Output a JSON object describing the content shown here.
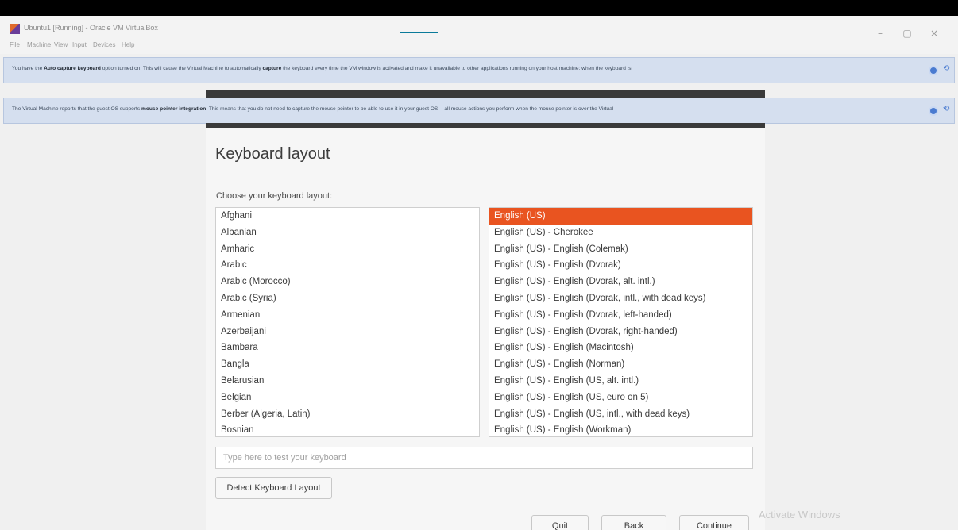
{
  "window": {
    "title": "Ubuntu1 [Running] - Oracle VM VirtualBox",
    "minimize_label": "–",
    "maximize_label": "▢",
    "close_label": "×"
  },
  "menu": [
    "File",
    "Machine",
    "View",
    "Input",
    "Devices",
    "Help"
  ],
  "notices": {
    "keyboard": {
      "pre": "You have the ",
      "bold1": "Auto capture keyboard",
      "mid1": " option turned on. This will cause the Virtual Machine to automatically ",
      "bold2": "capture",
      "post": " the keyboard every time the VM window is activated and make it unavailable to other applications running on your host machine: when the keyboard is"
    },
    "mouse": {
      "pre": "The Virtual Machine reports that the guest OS supports ",
      "bold": "mouse pointer integration",
      "post": ". This means that you do not need to capture the mouse pointer to be able to use it in your guest OS -- all mouse actions you perform when the mouse pointer is over the Virtual"
    },
    "close_label": "⟲"
  },
  "installer": {
    "title": "Keyboard layout",
    "choose_label": "Choose your keyboard layout:",
    "layouts": [
      "Afghani",
      "Albanian",
      "Amharic",
      "Arabic",
      "Arabic (Morocco)",
      "Arabic (Syria)",
      "Armenian",
      "Azerbaijani",
      "Bambara",
      "Bangla",
      "Belarusian",
      "Belgian",
      "Berber (Algeria, Latin)",
      "Bosnian"
    ],
    "variants": [
      "English (US)",
      "English (US) - Cherokee",
      "English (US) - English (Colemak)",
      "English (US) - English (Dvorak)",
      "English (US) - English (Dvorak, alt. intl.)",
      "English (US) - English (Dvorak, intl., with dead keys)",
      "English (US) - English (Dvorak, left-handed)",
      "English (US) - English (Dvorak, right-handed)",
      "English (US) - English (Macintosh)",
      "English (US) - English (Norman)",
      "English (US) - English (US, alt. intl.)",
      "English (US) - English (US, euro on 5)",
      "English (US) - English (US, intl., with dead keys)",
      "English (US) - English (Workman)"
    ],
    "selected_variant": "English (US)",
    "test_placeholder": "Type here to test your keyboard",
    "detect_button": "Detect Keyboard Layout",
    "quit_button": "Quit",
    "back_button": "Back",
    "continue_button": "Continue"
  },
  "watermark": "Activate Windows",
  "colors": {
    "selection": "#e95420",
    "notice_bg": "#d5dfef",
    "notice_icon": "#4a7bd0"
  }
}
